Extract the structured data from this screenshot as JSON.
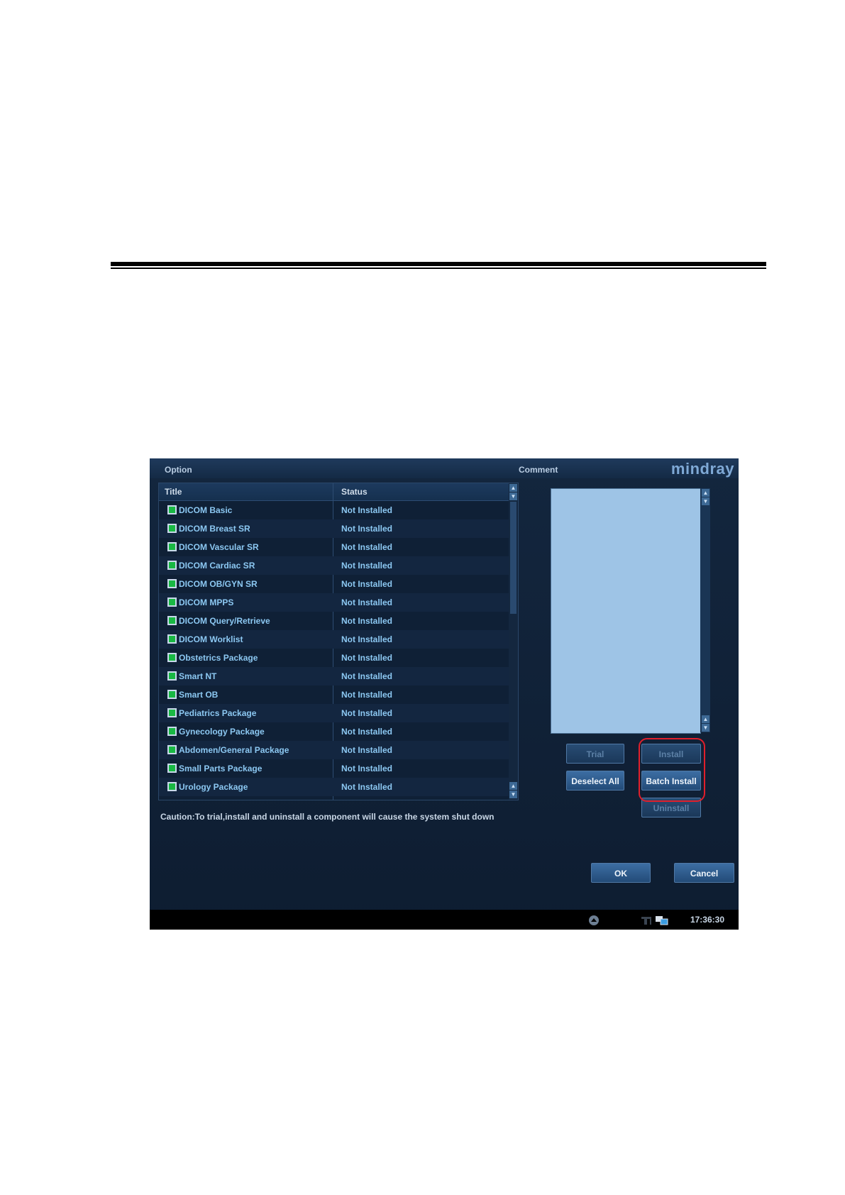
{
  "window": {
    "option_label": "Option",
    "comment_label": "Comment",
    "logo": "mindray"
  },
  "list": {
    "headers": {
      "title": "Title",
      "status": "Status"
    },
    "rows": [
      {
        "title": "DICOM Basic",
        "status": "Not Installed",
        "checked": true
      },
      {
        "title": "DICOM Breast SR",
        "status": "Not Installed",
        "checked": true
      },
      {
        "title": "DICOM Vascular SR",
        "status": "Not Installed",
        "checked": true
      },
      {
        "title": "DICOM Cardiac SR",
        "status": "Not Installed",
        "checked": true
      },
      {
        "title": "DICOM OB/GYN SR",
        "status": "Not Installed",
        "checked": true
      },
      {
        "title": "DICOM MPPS",
        "status": "Not Installed",
        "checked": true
      },
      {
        "title": "DICOM Query/Retrieve",
        "status": "Not Installed",
        "checked": true
      },
      {
        "title": "DICOM Worklist",
        "status": "Not Installed",
        "checked": true
      },
      {
        "title": "Obstetrics Package",
        "status": "Not Installed",
        "checked": true
      },
      {
        "title": "Smart NT",
        "status": "Not Installed",
        "checked": true
      },
      {
        "title": "Smart OB",
        "status": "Not Installed",
        "checked": true
      },
      {
        "title": "Pediatrics Package",
        "status": "Not Installed",
        "checked": true
      },
      {
        "title": "Gynecology Package",
        "status": "Not Installed",
        "checked": true
      },
      {
        "title": "Abdomen/General Package",
        "status": "Not Installed",
        "checked": true
      },
      {
        "title": "Small Parts Package",
        "status": "Not Installed",
        "checked": true
      },
      {
        "title": "Urology Package",
        "status": "Not Installed",
        "checked": true
      }
    ]
  },
  "buttons": {
    "trial": "Trial",
    "install": "Install",
    "deselect_all": "Deselect All",
    "batch_install": "Batch Install",
    "uninstall": "Uninstall",
    "ok": "OK",
    "cancel": "Cancel"
  },
  "caution": "Caution:To trial,install and uninstall a component will cause the system shut down",
  "statusbar": {
    "time": "17:36:30",
    "icons": [
      "eject-icon",
      "probe-icon",
      "network-icon"
    ]
  },
  "colors": {
    "window_bg": "#13263e",
    "row_text": "#8cc8f2",
    "checkbox": "#19b843",
    "comment_bg": "#9ec4e6",
    "highlight": "#e01f2b"
  }
}
